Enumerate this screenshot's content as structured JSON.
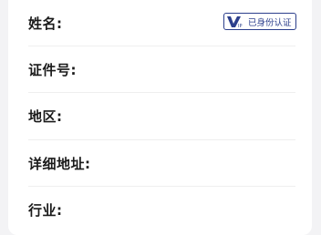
{
  "form": {
    "rows": [
      {
        "label": "姓名:",
        "value": ""
      },
      {
        "label": "证件号:",
        "value": ""
      },
      {
        "label": "地区:",
        "value": ""
      },
      {
        "label": "详细地址:",
        "value": ""
      },
      {
        "label": "行业:",
        "value": ""
      }
    ],
    "verification_badge": {
      "icon": "vip-icon",
      "text": "已身份认证"
    }
  },
  "colors": {
    "page_background": "#f3f3f5",
    "card_background": "#ffffff",
    "label_text": "#1a1a1a",
    "badge_accent": "#2c3f8c",
    "divider": "#efefef"
  }
}
